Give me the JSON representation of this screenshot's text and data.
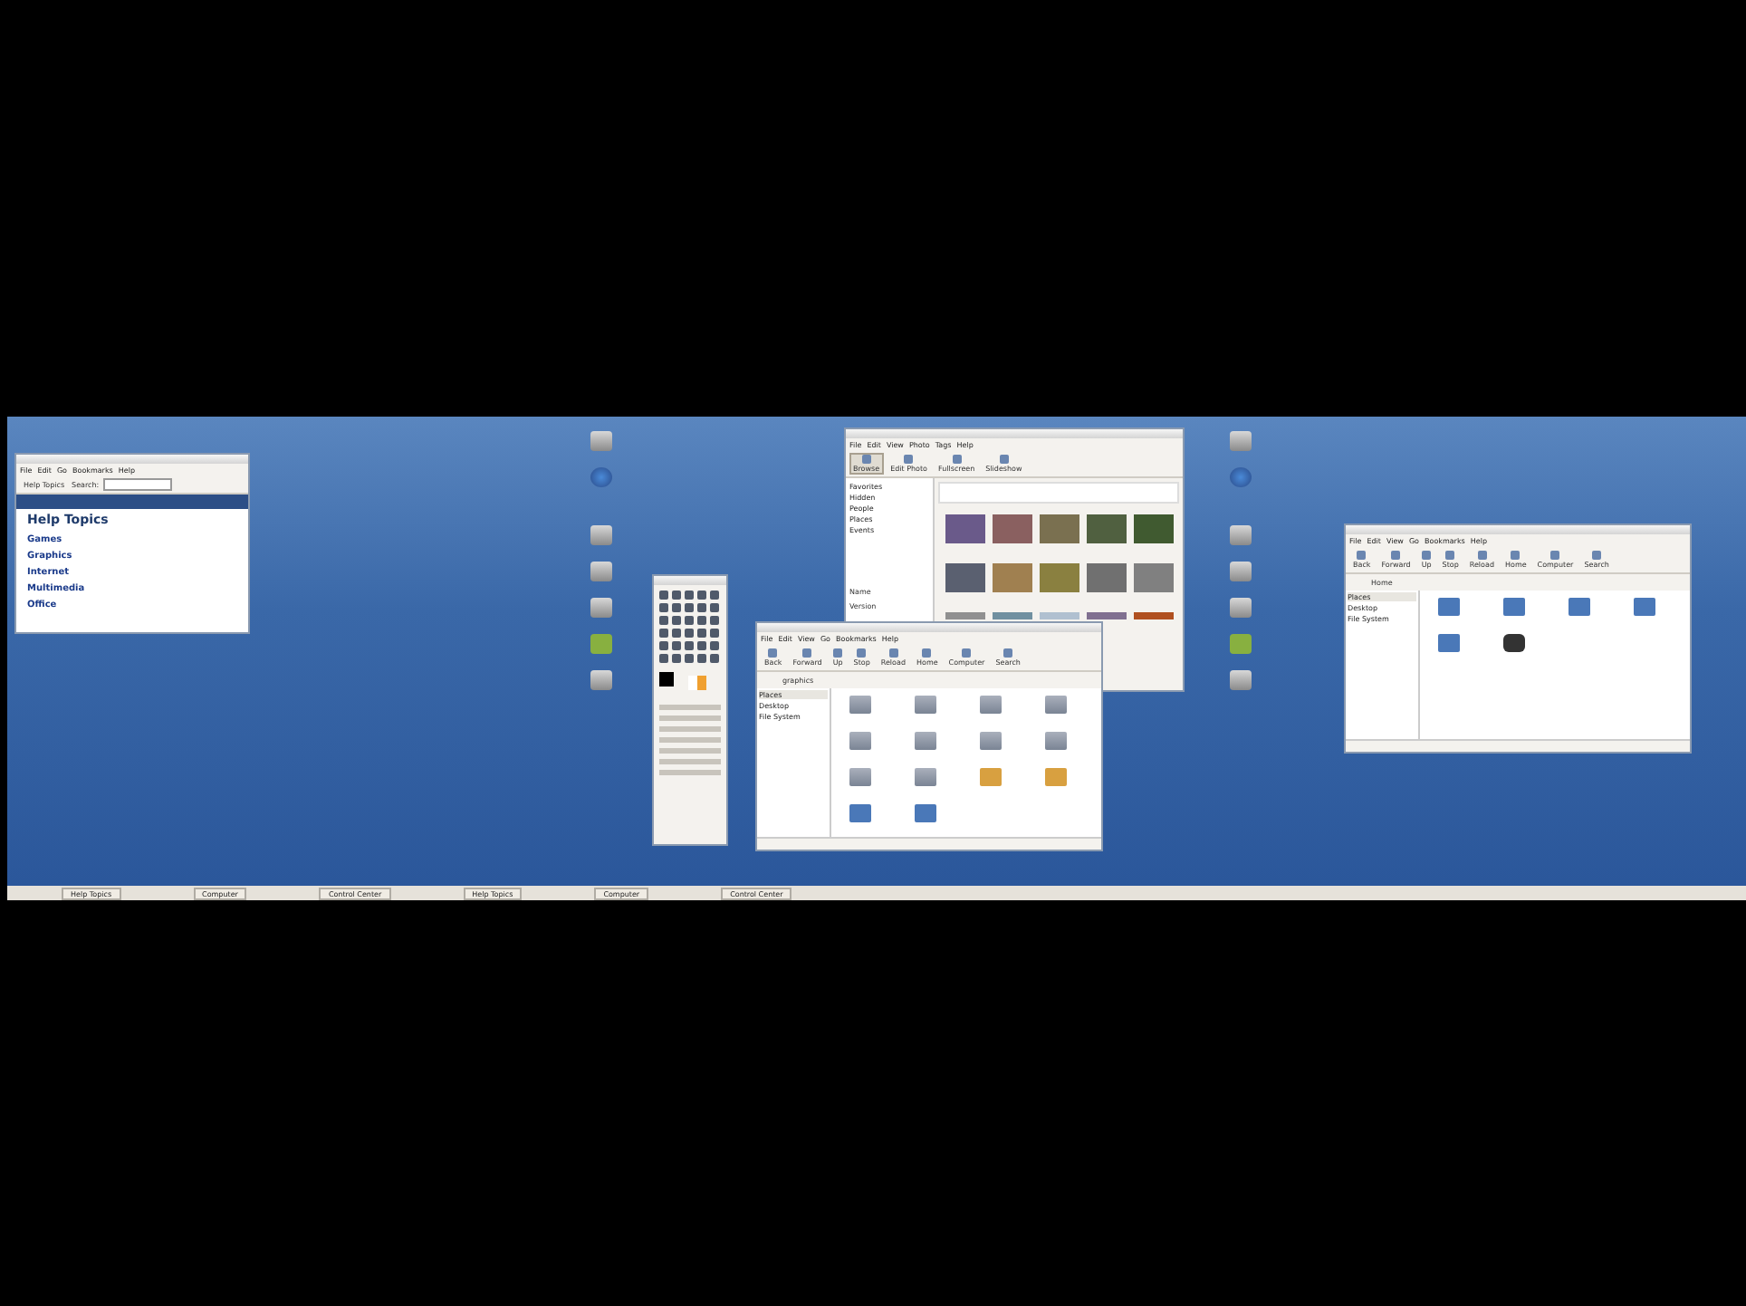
{
  "help_window": {
    "menu": [
      "File",
      "Edit",
      "Go",
      "Bookmarks",
      "Help"
    ],
    "toolbar_button": "Help Topics",
    "search_label": "Search:",
    "heading": "Help Topics",
    "links": [
      "Games",
      "Graphics",
      "Internet",
      "Multimedia",
      "Office"
    ]
  },
  "photo_window": {
    "menu": [
      "File",
      "Edit",
      "View",
      "Photo",
      "Tags",
      "Help"
    ],
    "modes": [
      {
        "label": "Browse",
        "selected": true
      },
      {
        "label": "Edit Photo",
        "selected": false
      },
      {
        "label": "Fullscreen",
        "selected": false
      },
      {
        "label": "Slideshow",
        "selected": false
      }
    ],
    "tags": [
      "Favorites",
      "Hidden",
      "People",
      "Places",
      "Events"
    ],
    "info_labels": [
      "Name",
      "Version"
    ]
  },
  "file_windows": [
    {
      "menu": [
        "File",
        "Edit",
        "View",
        "Go",
        "Bookmarks",
        "Help"
      ],
      "toolbar": [
        "Back",
        "Forward",
        "Up",
        "Stop",
        "Reload",
        "Home",
        "Computer",
        "Search"
      ],
      "path": [
        "graphics"
      ],
      "sidebar_title": "Places",
      "places": [
        "Desktop",
        "File System"
      ],
      "files": [
        {
          "kind": "folder"
        },
        {
          "kind": "folder"
        },
        {
          "kind": "folder"
        },
        {
          "kind": "folder"
        },
        {
          "kind": "folder"
        },
        {
          "kind": "folder"
        },
        {
          "kind": "folder"
        },
        {
          "kind": "folder"
        },
        {
          "kind": "folder"
        },
        {
          "kind": "folder"
        },
        {
          "kind": "package"
        },
        {
          "kind": "package"
        },
        {
          "kind": "image"
        },
        {
          "kind": "image"
        }
      ]
    },
    {
      "menu": [
        "File",
        "Edit",
        "View",
        "Go",
        "Bookmarks",
        "Help"
      ],
      "toolbar": [
        "Back",
        "Forward",
        "Up",
        "Stop",
        "Reload",
        "Home",
        "Computer",
        "Search"
      ],
      "path": [
        "Home"
      ],
      "sidebar_title": "Places",
      "places": [
        "Desktop",
        "File System"
      ],
      "files": [
        {
          "kind": "image"
        },
        {
          "kind": "image"
        },
        {
          "kind": "image"
        },
        {
          "kind": "image"
        },
        {
          "kind": "image"
        },
        {
          "kind": "camera"
        }
      ]
    }
  ],
  "taskbar": [
    {
      "label": "Help Topics"
    },
    {
      "label": "Computer"
    },
    {
      "label": "Control Center"
    },
    {
      "label": "Help Topics"
    },
    {
      "label": "Computer"
    },
    {
      "label": "Control Center"
    }
  ]
}
